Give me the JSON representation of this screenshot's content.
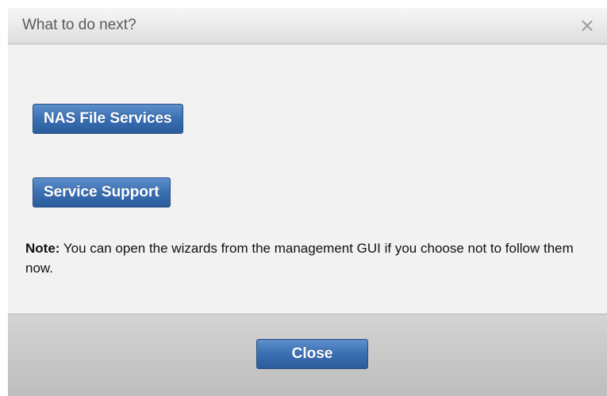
{
  "dialog": {
    "title": "What to do next?",
    "close_icon": "close-icon",
    "buttons": {
      "nas_file_services": "NAS File Services",
      "service_support": "Service Support"
    },
    "note": {
      "label": "Note:",
      "text": " You can open the wizards from the management GUI if you choose not to follow them now."
    },
    "footer": {
      "close_label": "Close"
    }
  },
  "colors": {
    "button_blue": "#3a6fb2",
    "title_text": "#5a5a5a",
    "content_bg": "#f2f2f2"
  }
}
